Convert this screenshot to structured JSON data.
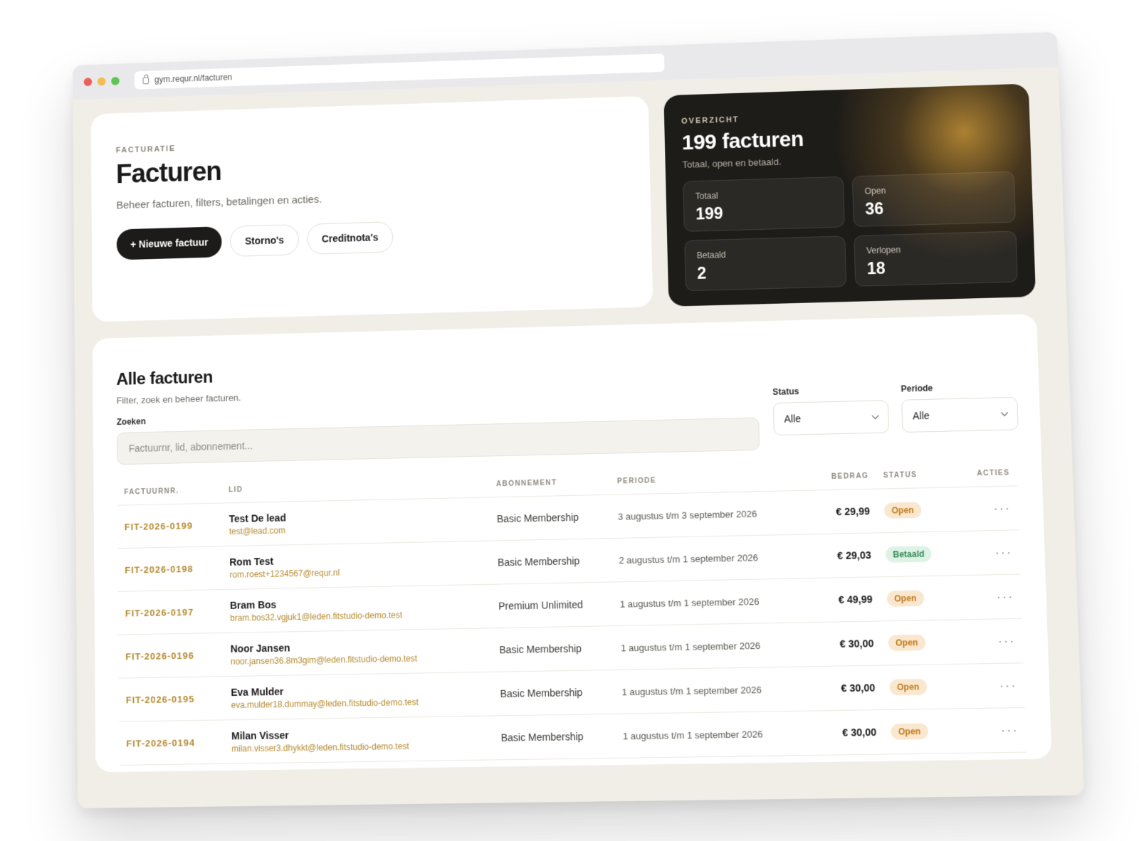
{
  "browser": {
    "url": "gym.requr.nl/facturen"
  },
  "hero": {
    "eyebrow": "FACTURATIE",
    "title": "Facturen",
    "subtitle": "Beheer facturen, filters, betalingen en acties.",
    "buttons": {
      "new": "+ Nieuwe factuur",
      "storno": "Storno's",
      "credit": "Creditnota's"
    }
  },
  "overview": {
    "eyebrow": "OVERZICHT",
    "title": "199 facturen",
    "subtitle": "Totaal, open en betaald.",
    "stats": [
      {
        "label": "Totaal",
        "value": "199"
      },
      {
        "label": "Open",
        "value": "36"
      },
      {
        "label": "Betaald",
        "value": "2"
      },
      {
        "label": "Verlopen",
        "value": "18"
      }
    ]
  },
  "list": {
    "title": "Alle facturen",
    "subtitle": "Filter, zoek en beheer facturen.",
    "search_label": "Zoeken",
    "search_placeholder": "Factuurnr, lid, abonnement...",
    "status_label": "Status",
    "status_value": "Alle",
    "period_label": "Periode",
    "period_value": "Alle",
    "columns": [
      "FACTUURNR.",
      "LID",
      "ABONNEMENT",
      "PERIODE",
      "BEDRAG",
      "STATUS",
      "ACTIES"
    ],
    "rows": [
      {
        "nr": "FIT-2026-0199",
        "name": "Test De lead",
        "email": "test@lead.com",
        "plan": "Basic Membership",
        "period": "3 augustus t/m 3 september 2026",
        "amount": "€ 29,99",
        "status": "Open",
        "status_type": "open"
      },
      {
        "nr": "FIT-2026-0198",
        "name": "Rom Test",
        "email": "rom.roest+1234567@requr.nl",
        "plan": "Basic Membership",
        "period": "2 augustus t/m 1 september 2026",
        "amount": "€ 29,03",
        "status": "Betaald",
        "status_type": "paid"
      },
      {
        "nr": "FIT-2026-0197",
        "name": "Bram Bos",
        "email": "bram.bos32.vgjuk1@leden.fitstudio-demo.test",
        "plan": "Premium Unlimited",
        "period": "1 augustus t/m 1 september 2026",
        "amount": "€ 49,99",
        "status": "Open",
        "status_type": "open"
      },
      {
        "nr": "FIT-2026-0196",
        "name": "Noor Jansen",
        "email": "noor.jansen36.8m3gim@leden.fitstudio-demo.test",
        "plan": "Basic Membership",
        "period": "1 augustus t/m 1 september 2026",
        "amount": "€ 30,00",
        "status": "Open",
        "status_type": "open"
      },
      {
        "nr": "FIT-2026-0195",
        "name": "Eva Mulder",
        "email": "eva.mulder18.dummay@leden.fitstudio-demo.test",
        "plan": "Basic Membership",
        "period": "1 augustus t/m 1 september 2026",
        "amount": "€ 30,00",
        "status": "Open",
        "status_type": "open"
      },
      {
        "nr": "FIT-2026-0194",
        "name": "Milan Visser",
        "email": "milan.visser3.dhykkt@leden.fitstudio-demo.test",
        "plan": "Basic Membership",
        "period": "1 augustus t/m 1 september 2026",
        "amount": "€ 30,00",
        "status": "Open",
        "status_type": "open"
      }
    ],
    "row_actions_label": "···"
  }
}
